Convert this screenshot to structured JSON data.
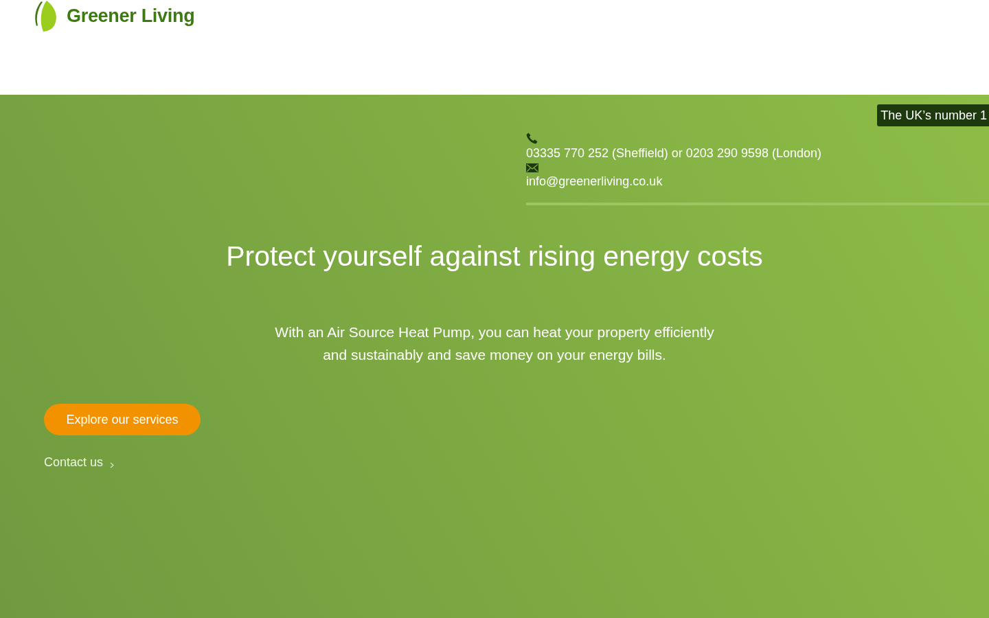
{
  "header": {
    "logo": {
      "text": "Greener Living"
    }
  },
  "hero": {
    "badge": "The UK’s number 1",
    "contact": {
      "phone": "03335 770 252 (Sheffield) or 0203 290 9598 (London)",
      "email": "info@greenerliving.co.uk"
    },
    "headline": "Protect yourself against rising energy costs",
    "subtitle": "With an Air Source Heat Pump, you can heat your property efficiently and sustainably and save money on your energy bills.",
    "primary_button": "Explore our services",
    "secondary_link": "Contact us"
  }
}
